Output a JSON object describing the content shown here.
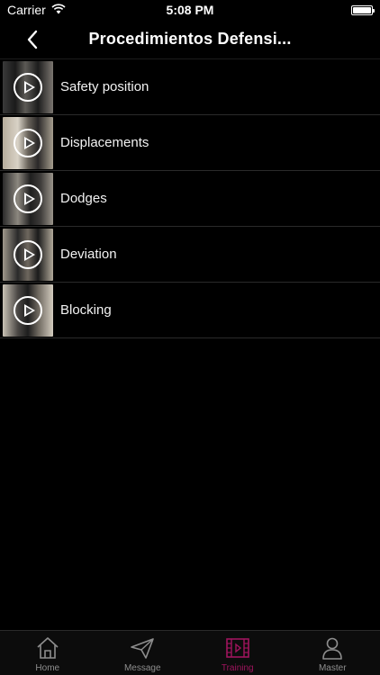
{
  "status_bar": {
    "carrier": "Carrier",
    "time": "5:08 PM",
    "battery_level": 1.0
  },
  "nav": {
    "title": "Procedimientos Defensi...",
    "back_icon": "chevron-left-icon"
  },
  "list": {
    "items": [
      {
        "label": "Safety position",
        "icon": "play-icon"
      },
      {
        "label": "Displacements",
        "icon": "play-icon"
      },
      {
        "label": "Dodges",
        "icon": "play-icon"
      },
      {
        "label": "Deviation",
        "icon": "play-icon"
      },
      {
        "label": "Blocking",
        "icon": "play-icon"
      }
    ]
  },
  "tab_bar": {
    "active_color": "#a0145e",
    "inactive_color": "#8e8e8e",
    "tabs": [
      {
        "label": "Home",
        "icon": "home-icon"
      },
      {
        "label": "Message",
        "icon": "paper-plane-icon"
      },
      {
        "label": "Training",
        "icon": "film-icon",
        "active": true
      },
      {
        "label": "Master",
        "icon": "person-icon"
      }
    ]
  }
}
